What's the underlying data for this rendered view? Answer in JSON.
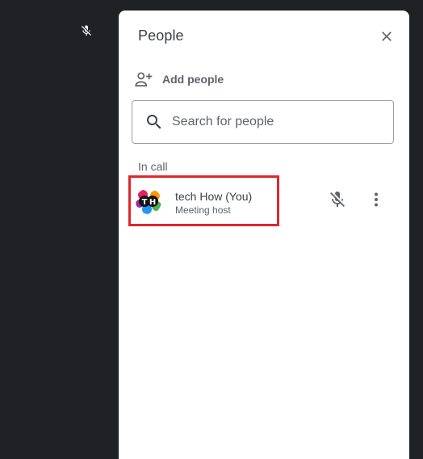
{
  "background": {
    "color": "#202124",
    "mic_icon": "mic-off-icon"
  },
  "panel": {
    "title": "People",
    "close_icon": "close-icon",
    "add_people": {
      "label": "Add people",
      "icon": "person-add-icon"
    },
    "search": {
      "placeholder": "Search for people",
      "value": "",
      "icon": "search-icon"
    },
    "section_label": "In call",
    "participants": [
      {
        "name": "tech How (You)",
        "role": "Meeting host",
        "avatar_text": "TH",
        "mic_icon": "mic-off-icon",
        "more_icon": "more-vert-icon",
        "highlighted": true,
        "highlight_color": "#e0262e"
      }
    ]
  }
}
